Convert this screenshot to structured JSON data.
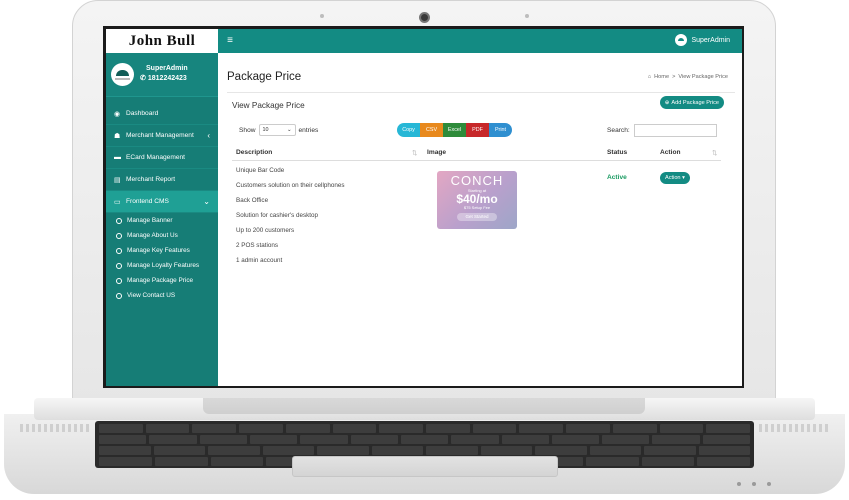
{
  "brand": {
    "logo_text": "John Bull"
  },
  "navbar": {
    "menu_icon": "≡",
    "user_name": "SuperAdmin"
  },
  "sidebar": {
    "user_name": "SuperAdmin",
    "user_phone": "1812242423",
    "items": [
      {
        "label": "Dashboard",
        "icon": "dashboard-icon"
      },
      {
        "label": "Merchant Management",
        "icon": "users-icon"
      },
      {
        "label": "ECard Management",
        "icon": "card-icon"
      },
      {
        "label": "Merchant Report",
        "icon": "file-icon"
      },
      {
        "label": "Frontend CMS",
        "icon": "folder-icon"
      }
    ],
    "subitems": [
      {
        "label": "Manage Banner"
      },
      {
        "label": "Manage About Us"
      },
      {
        "label": "Manage Key Features"
      },
      {
        "label": "Manage Loyalty Features"
      },
      {
        "label": "Manage Package Price"
      },
      {
        "label": "View Contact US"
      }
    ]
  },
  "page": {
    "title": "Package Price",
    "breadcrumb_home": "Home",
    "breadcrumb_sep": ">",
    "breadcrumb_current": "View Package Price",
    "subtitle": "View Package Price",
    "add_button": "Add Package Price"
  },
  "table_controls": {
    "show_label": "Show",
    "entries_value": "10",
    "entries_label": "entries",
    "search_label": "Search:",
    "export_buttons": [
      {
        "label": "Copy",
        "color": "#27b7d6"
      },
      {
        "label": "CSV",
        "color": "#e8891d"
      },
      {
        "label": "Excel",
        "color": "#2e8b3a"
      },
      {
        "label": "PDF",
        "color": "#c7282a"
      },
      {
        "label": "Print",
        "color": "#2f8fd0"
      }
    ]
  },
  "table": {
    "headers": [
      "Description",
      "Image",
      "Status",
      "Action"
    ],
    "row": {
      "description_lines": [
        "Unique Bar Code",
        "Customers solution on their cellphones",
        "Back Office",
        "Solution for cashier's desktop",
        "Up to 200 customers",
        "2 POS stations",
        "1 admin account"
      ],
      "image": {
        "brand": "CONCH",
        "small": "Starting at",
        "price": "$40/mo",
        "fee": "$75 Setup Fee",
        "cta": "Get Started"
      },
      "status": "Active",
      "action": "Action ▾"
    }
  },
  "colors": {
    "accent": "#138b83",
    "sidebar": "#167d76",
    "active_menu": "#1fa095",
    "status_active": "#1a9b62"
  }
}
